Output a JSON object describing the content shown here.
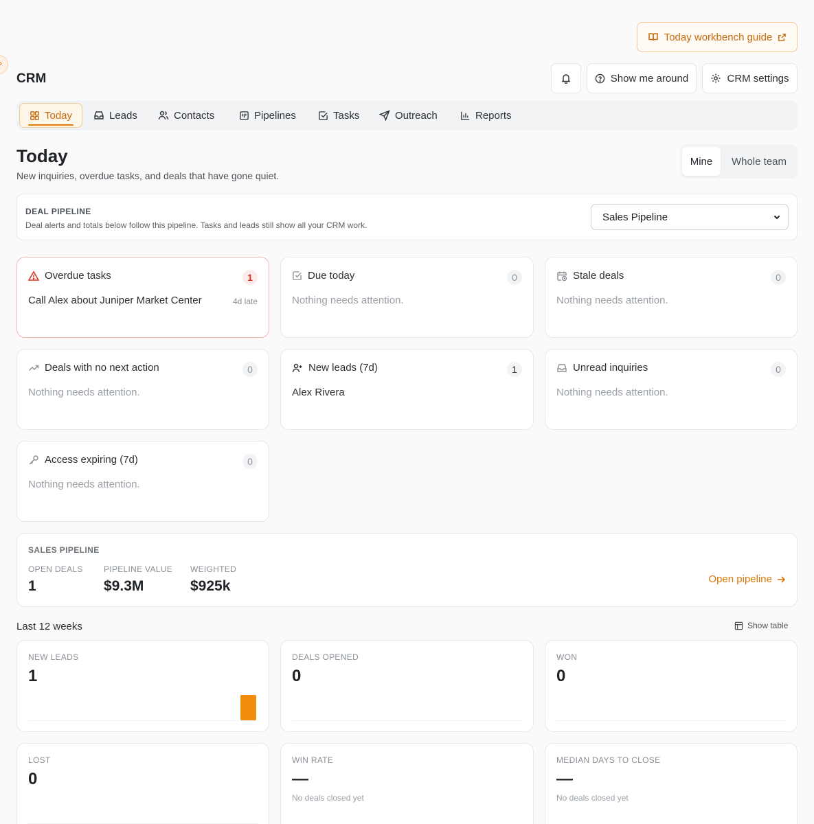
{
  "guide": {
    "label": "Today workbench guide"
  },
  "app": {
    "title": "CRM"
  },
  "header": {
    "show_me_around": "Show me around",
    "crm_settings": "CRM settings"
  },
  "nav": {
    "items": [
      {
        "label": "Today",
        "icon": "grid-icon",
        "active": true
      },
      {
        "label": "Leads",
        "icon": "inbox-icon"
      },
      {
        "label": "Contacts",
        "icon": "users-icon"
      },
      {
        "label": "Pipelines",
        "icon": "kanban-icon"
      },
      {
        "label": "Tasks",
        "icon": "check-square-icon"
      },
      {
        "label": "Outreach",
        "icon": "send-icon"
      },
      {
        "label": "Reports",
        "icon": "bar-chart-icon"
      }
    ]
  },
  "page": {
    "title": "Today",
    "subtitle": "New inquiries, overdue tasks, and deals that have gone quiet."
  },
  "scope": {
    "mine": "Mine",
    "whole_team": "Whole team",
    "selected": "Mine"
  },
  "deal_pipeline": {
    "label": "DEAL PIPELINE",
    "description": "Deal alerts and totals below follow this pipeline. Tasks and leads still show all your CRM work.",
    "selected": "Sales Pipeline"
  },
  "alerts": {
    "overdue": {
      "title": "Overdue tasks",
      "count": "1",
      "item": "Call Alex about Juniper Market Center",
      "late": "4d late"
    },
    "due_today": {
      "title": "Due today",
      "count": "0",
      "empty": "Nothing needs attention."
    },
    "stale": {
      "title": "Stale deals",
      "count": "0",
      "empty": "Nothing needs attention."
    },
    "no_next": {
      "title": "Deals with no next action",
      "count": "0",
      "empty": "Nothing needs attention."
    },
    "new_leads": {
      "title": "New leads (7d)",
      "count": "1",
      "item": "Alex Rivera"
    },
    "unread": {
      "title": "Unread inquiries",
      "count": "0",
      "empty": "Nothing needs attention."
    },
    "access": {
      "title": "Access expiring (7d)",
      "count": "0",
      "empty": "Nothing needs attention."
    }
  },
  "sales_pipeline": {
    "label": "SALES PIPELINE",
    "open_deals_label": "OPEN DEALS",
    "open_deals": "1",
    "value_label": "PIPELINE VALUE",
    "value": "$9.3M",
    "weighted_label": "WEIGHTED",
    "weighted": "$925k",
    "open_link": "Open pipeline"
  },
  "weeks": {
    "title": "Last 12 weeks",
    "show_table": "Show table",
    "metrics": [
      {
        "label": "NEW LEADS",
        "value": "1"
      },
      {
        "label": "DEALS OPENED",
        "value": "0"
      },
      {
        "label": "WON",
        "value": "0"
      },
      {
        "label": "LOST",
        "value": "0"
      },
      {
        "label": "WIN RATE",
        "value": "—",
        "note": "No deals closed yet"
      },
      {
        "label": "MEDIAN DAYS TO CLOSE",
        "value": "—",
        "note": "No deals closed yet"
      }
    ]
  },
  "colors": {
    "accent": "#d97706",
    "alert": "#d92d20",
    "bar": "#f28c0c"
  }
}
